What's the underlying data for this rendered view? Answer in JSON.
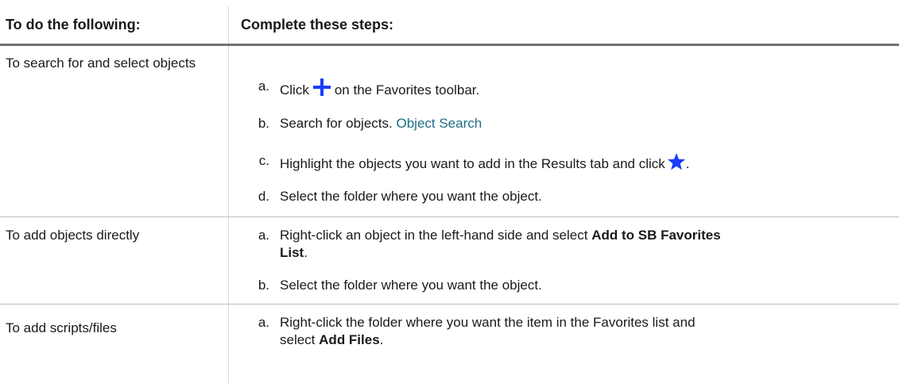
{
  "header": {
    "col1": "To do the following:",
    "col2": "Complete these steps:"
  },
  "rows": [
    {
      "task": "To search for and select objects",
      "steps": [
        {
          "letter": "a.",
          "before": "Click",
          "icon": "plus-icon",
          "after": "on the Favorites toolbar."
        },
        {
          "letter": "b.",
          "before": "Search for objects.",
          "link": "Object Search"
        },
        {
          "letter": "c.",
          "before": "Highlight the objects you want to add in the Results tab and click",
          "icon": "star-icon",
          "after": "."
        },
        {
          "letter": "d.",
          "before": "Select the folder where you want the object."
        }
      ]
    },
    {
      "task": "To add objects directly",
      "steps": [
        {
          "letter": "a.",
          "before": "Right-click an object in the left-hand side and select",
          "bold": "Add to SB Favorites List",
          "after": "."
        },
        {
          "letter": "b.",
          "before": "Select the folder where you want the object."
        }
      ]
    },
    {
      "task": "To add scripts/files",
      "steps": [
        {
          "letter": "a.",
          "before": "Right-click the folder where you want the item in the Favorites list and select",
          "bold": "Add Files",
          "after": "."
        }
      ]
    }
  ],
  "colors": {
    "link": "#1f6e84",
    "icon_blue": "#1a3cff",
    "header_rule": "#737373"
  }
}
